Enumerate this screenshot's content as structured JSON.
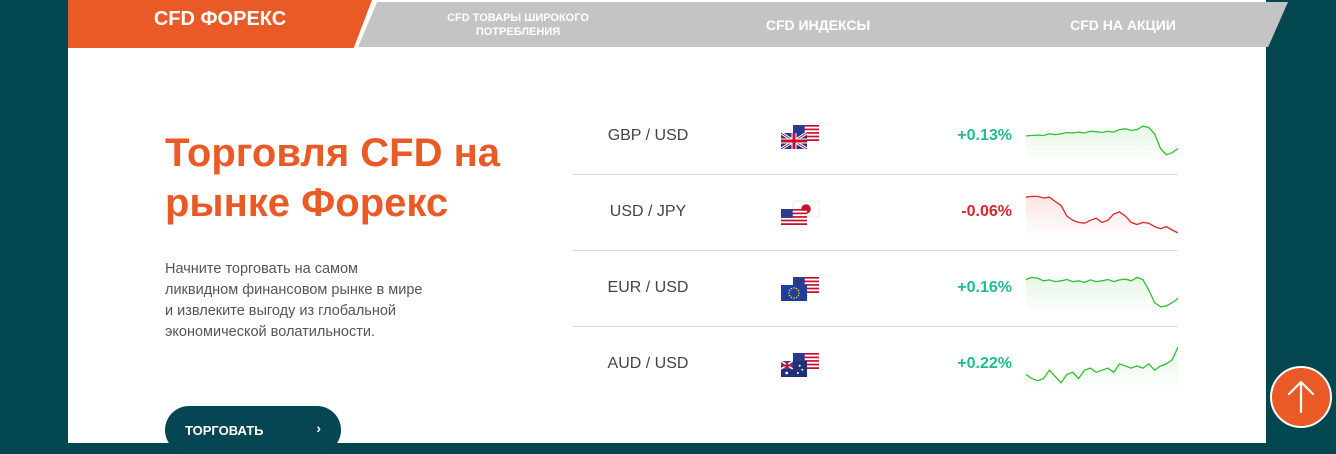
{
  "tabs": [
    {
      "label": "CFD ФОРЕКС"
    },
    {
      "label": "CFD ТОВАРЫ ШИРОКОГО ПОТРЕБЛЕНИЯ"
    },
    {
      "label": "CFD ИНДЕКСЫ"
    },
    {
      "label": "CFD НА АКЦИИ"
    }
  ],
  "hero": {
    "title": "Торговля CFD на рынке Форекс",
    "description": "Начните торговать на самом ликвидном финансовом рынке в мире и извлеките выгоду из глобальной экономической волатильности.",
    "cta_label": "ТОРГОВАТЬ",
    "cta_arrow": "›"
  },
  "quotes": [
    {
      "pair": "GBP / USD",
      "change": "+0.13%",
      "direction": "up",
      "flags": [
        "gb-flag-icon",
        "us-flag-icon"
      ],
      "series": [
        0.55,
        0.56,
        0.57,
        0.56,
        0.6,
        0.58,
        0.6,
        0.63,
        0.62,
        0.64,
        0.62,
        0.66,
        0.65,
        0.63,
        0.66,
        0.64,
        0.7,
        0.72,
        0.68,
        0.7,
        0.78,
        0.75,
        0.6,
        0.25,
        0.1,
        0.15,
        0.25
      ]
    },
    {
      "pair": "USD / JPY",
      "change": "-0.06%",
      "direction": "down",
      "flags": [
        "us-flag-icon",
        "jp-flag-icon"
      ],
      "series": [
        0.9,
        0.92,
        0.92,
        0.88,
        0.9,
        0.8,
        0.7,
        0.45,
        0.35,
        0.3,
        0.28,
        0.35,
        0.4,
        0.3,
        0.35,
        0.5,
        0.55,
        0.45,
        0.3,
        0.25,
        0.3,
        0.28,
        0.2,
        0.15,
        0.2,
        0.12,
        0.05
      ]
    },
    {
      "pair": "EUR / USD",
      "change": "+0.16%",
      "direction": "up",
      "flags": [
        "eu-flag-icon",
        "us-flag-icon"
      ],
      "series": [
        0.75,
        0.8,
        0.78,
        0.72,
        0.74,
        0.7,
        0.72,
        0.75,
        0.7,
        0.72,
        0.68,
        0.74,
        0.7,
        0.72,
        0.75,
        0.7,
        0.74,
        0.76,
        0.72,
        0.8,
        0.75,
        0.5,
        0.2,
        0.1,
        0.12,
        0.2,
        0.3
      ]
    },
    {
      "pair": "AUD / USD",
      "change": "+0.22%",
      "direction": "up",
      "flags": [
        "au-flag-icon",
        "us-flag-icon"
      ],
      "series": [
        0.3,
        0.2,
        0.15,
        0.2,
        0.4,
        0.25,
        0.1,
        0.3,
        0.35,
        0.2,
        0.4,
        0.45,
        0.35,
        0.4,
        0.45,
        0.35,
        0.55,
        0.5,
        0.45,
        0.5,
        0.45,
        0.55,
        0.4,
        0.5,
        0.55,
        0.65,
        0.95
      ]
    }
  ],
  "colors": {
    "accent": "#e95a27",
    "dark": "#054652",
    "positive": "#1fbc8e",
    "negative": "#d8262e",
    "spark_up": "#2ec12e",
    "spark_down": "#e02424"
  },
  "scroll_top_icon": "arrow-up-icon"
}
